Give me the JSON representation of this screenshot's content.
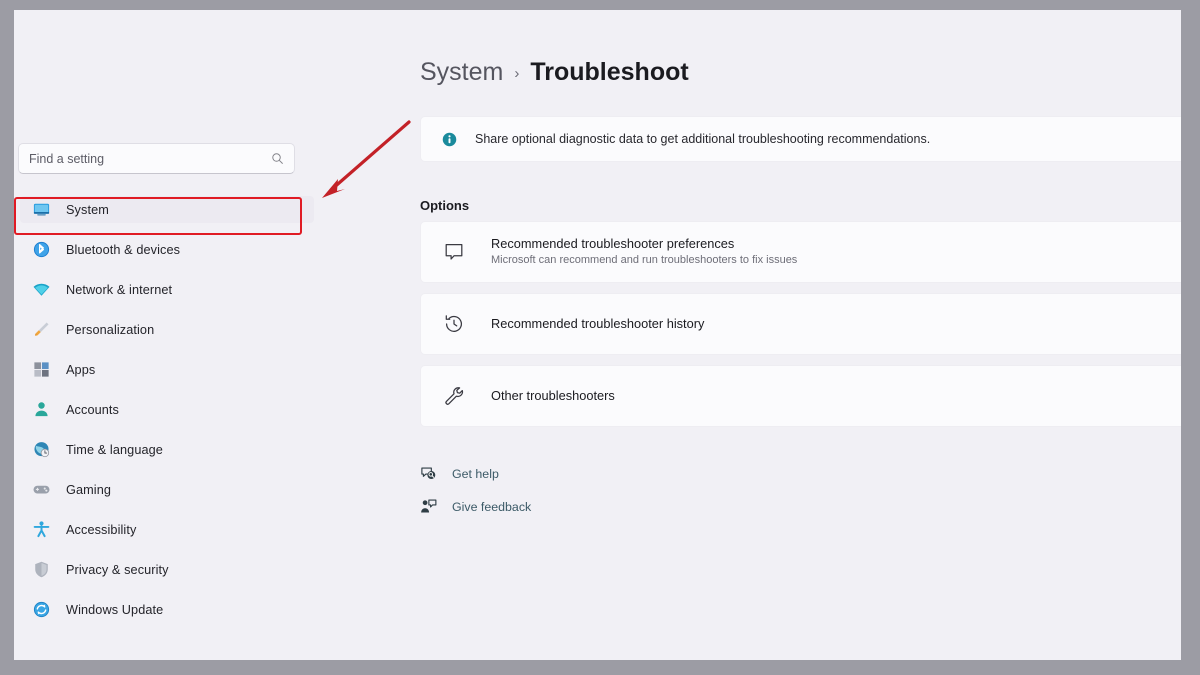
{
  "window": {
    "accent_color": "#0f6cbd",
    "background_color": "#f1f0f5",
    "card_color": "#fbfbfd",
    "annotation_color": "#e01b24",
    "link_color": "#3c5a67"
  },
  "search": {
    "placeholder": "Find a setting",
    "value": "",
    "icon": "search-icon"
  },
  "sidebar": {
    "items": [
      {
        "label": "System",
        "icon": "monitor-icon",
        "selected": true
      },
      {
        "label": "Bluetooth & devices",
        "icon": "bluetooth-icon",
        "selected": false
      },
      {
        "label": "Network & internet",
        "icon": "wifi-icon",
        "selected": false
      },
      {
        "label": "Personalization",
        "icon": "paintbrush-icon",
        "selected": false
      },
      {
        "label": "Apps",
        "icon": "apps-grid-icon",
        "selected": false
      },
      {
        "label": "Accounts",
        "icon": "person-icon",
        "selected": false
      },
      {
        "label": "Time & language",
        "icon": "globe-clock-icon",
        "selected": false
      },
      {
        "label": "Gaming",
        "icon": "gamepad-icon",
        "selected": false
      },
      {
        "label": "Accessibility",
        "icon": "accessibility-person-icon",
        "selected": false
      },
      {
        "label": "Privacy & security",
        "icon": "shield-icon",
        "selected": false
      },
      {
        "label": "Windows Update",
        "icon": "update-refresh-icon",
        "selected": false
      }
    ]
  },
  "breadcrumb": {
    "parent": "System",
    "separator": "›",
    "current": "Troubleshoot"
  },
  "banner": {
    "icon": "info-icon",
    "text": "Share optional diagnostic data to get additional troubleshooting recommendations."
  },
  "main": {
    "section_title": "Options",
    "cards": [
      {
        "icon": "speech-bubble-icon",
        "title": "Recommended troubleshooter preferences",
        "subtitle": "Microsoft can recommend and run troubleshooters to fix issues"
      },
      {
        "icon": "history-clock-icon",
        "title": "Recommended troubleshooter history",
        "subtitle": ""
      },
      {
        "icon": "wrench-icon",
        "title": "Other troubleshooters",
        "subtitle": ""
      }
    ],
    "links": [
      {
        "icon": "get-help-icon",
        "label": "Get help"
      },
      {
        "icon": "give-feedback-icon",
        "label": "Give feedback"
      }
    ]
  },
  "annotation": {
    "type": "red-arrow-and-box",
    "target": "System"
  }
}
